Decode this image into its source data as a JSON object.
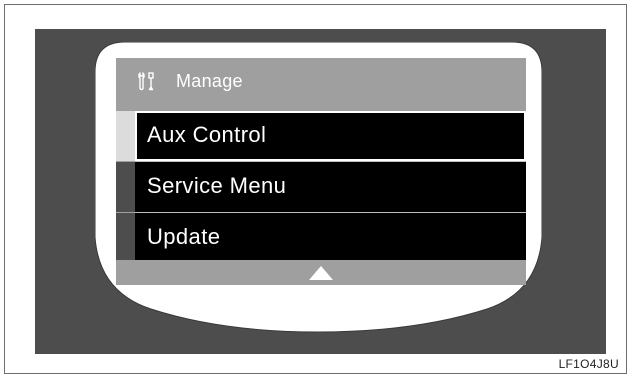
{
  "screen": {
    "header": {
      "icon": "wrench-screwdriver-icon",
      "title": "Manage"
    },
    "menu_items": [
      {
        "label": "Aux Control",
        "selected": true
      },
      {
        "label": "Service Menu",
        "selected": false
      },
      {
        "label": "Update",
        "selected": false
      }
    ],
    "scroll_indicator": "up-arrow-icon"
  },
  "figure_code": "LF1O4J8U",
  "colors": {
    "background_panel": "#4d4d4d",
    "bezel": "#ffffff",
    "screen_header": "#9f9f9f",
    "menu_row": "#000000",
    "menu_text": "#ffffff",
    "selection_outline": "#ffffff"
  }
}
